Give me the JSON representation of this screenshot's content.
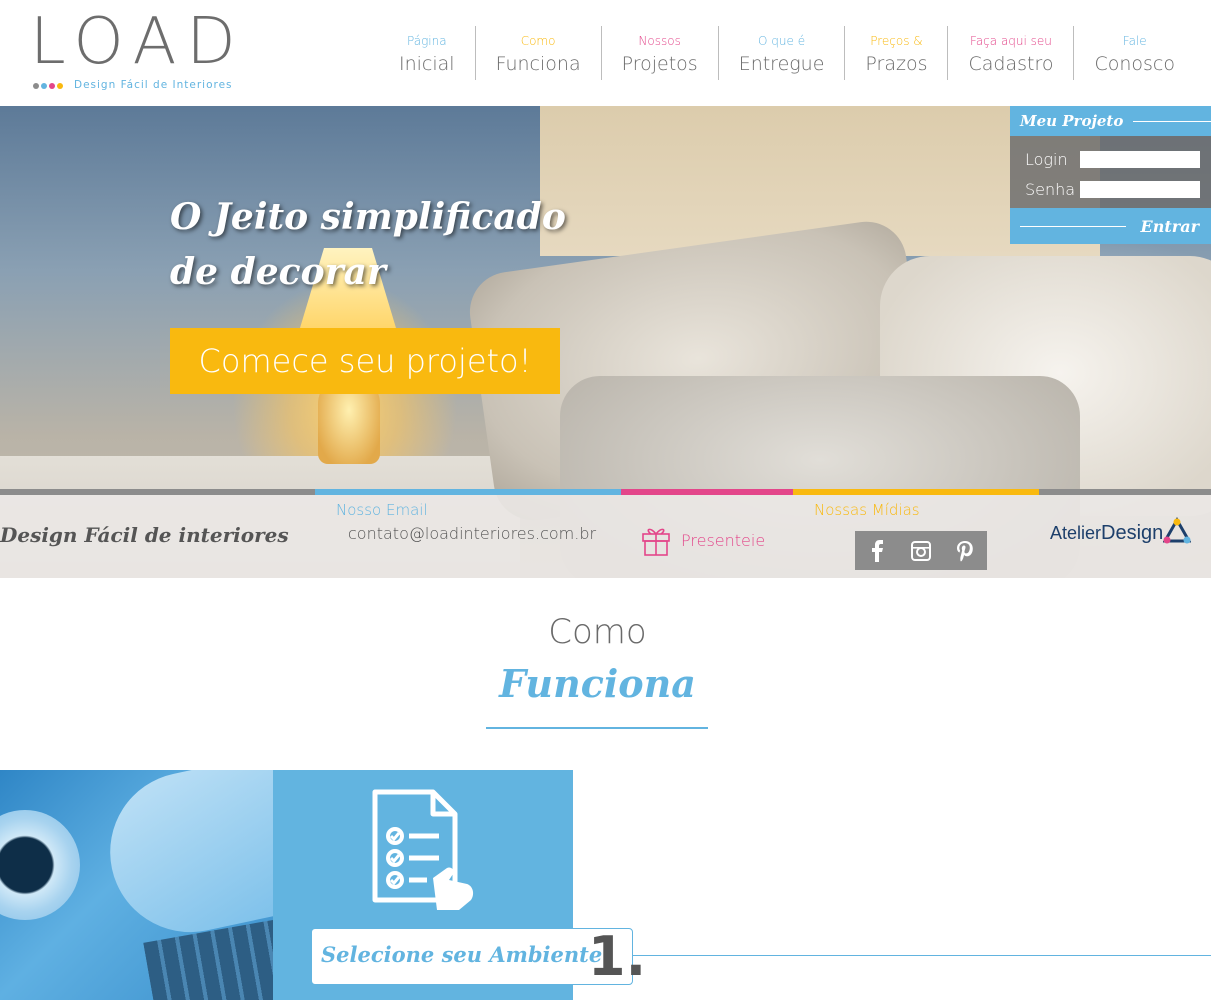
{
  "brand": {
    "logo_word": "LOAD",
    "tagline": "Design Fácil de Interiores",
    "dot_colors": [
      "#8c8c8c",
      "#62b4e0",
      "#e3468a",
      "#f9b90f"
    ]
  },
  "nav": {
    "items": [
      {
        "small": "Página",
        "big": "Inicial",
        "color": "#62b4e0"
      },
      {
        "small": "Como",
        "big": "Funciona",
        "color": "#f9b90f"
      },
      {
        "small": "Nossos",
        "big": "Projetos",
        "color": "#e3468a"
      },
      {
        "small": "O que é",
        "big": "Entregue",
        "color": "#62b4e0"
      },
      {
        "small": "Preços &",
        "big": "Prazos",
        "color": "#f9b90f"
      },
      {
        "small": "Faça aqui seu",
        "big": "Cadastro",
        "color": "#e3468a"
      },
      {
        "small": "Fale",
        "big": "Conosco",
        "color": "#62b4e0"
      }
    ]
  },
  "hero": {
    "title": "O Jeito simplificado de decorar",
    "cta": "Comece seu projeto!"
  },
  "login": {
    "header": "Meu Projeto",
    "login_label": "Login",
    "password_label": "Senha",
    "login_value": "",
    "password_value": "",
    "submit": "Entrar"
  },
  "infobar": {
    "brand_text": "Design Fácil de interiores",
    "email_label": "Nosso Email",
    "email": "contato@loadinteriores.com.br",
    "gift_label": "Presenteie",
    "media_label": "Nossas Mídias",
    "social_icons": [
      "facebook-icon",
      "instagram-icon",
      "pinterest-icon"
    ],
    "atelier_a": "Atelier",
    "atelier_b": "Design"
  },
  "how_it_works": {
    "small_title": "Como",
    "big_title": "Funciona",
    "steps": [
      {
        "label": "Selecione seu Ambiente",
        "number": "1."
      }
    ]
  },
  "colors": {
    "blue": "#62b4e0",
    "pink": "#e3468a",
    "yellow": "#f9b90f",
    "gray": "#8c8c8c"
  }
}
